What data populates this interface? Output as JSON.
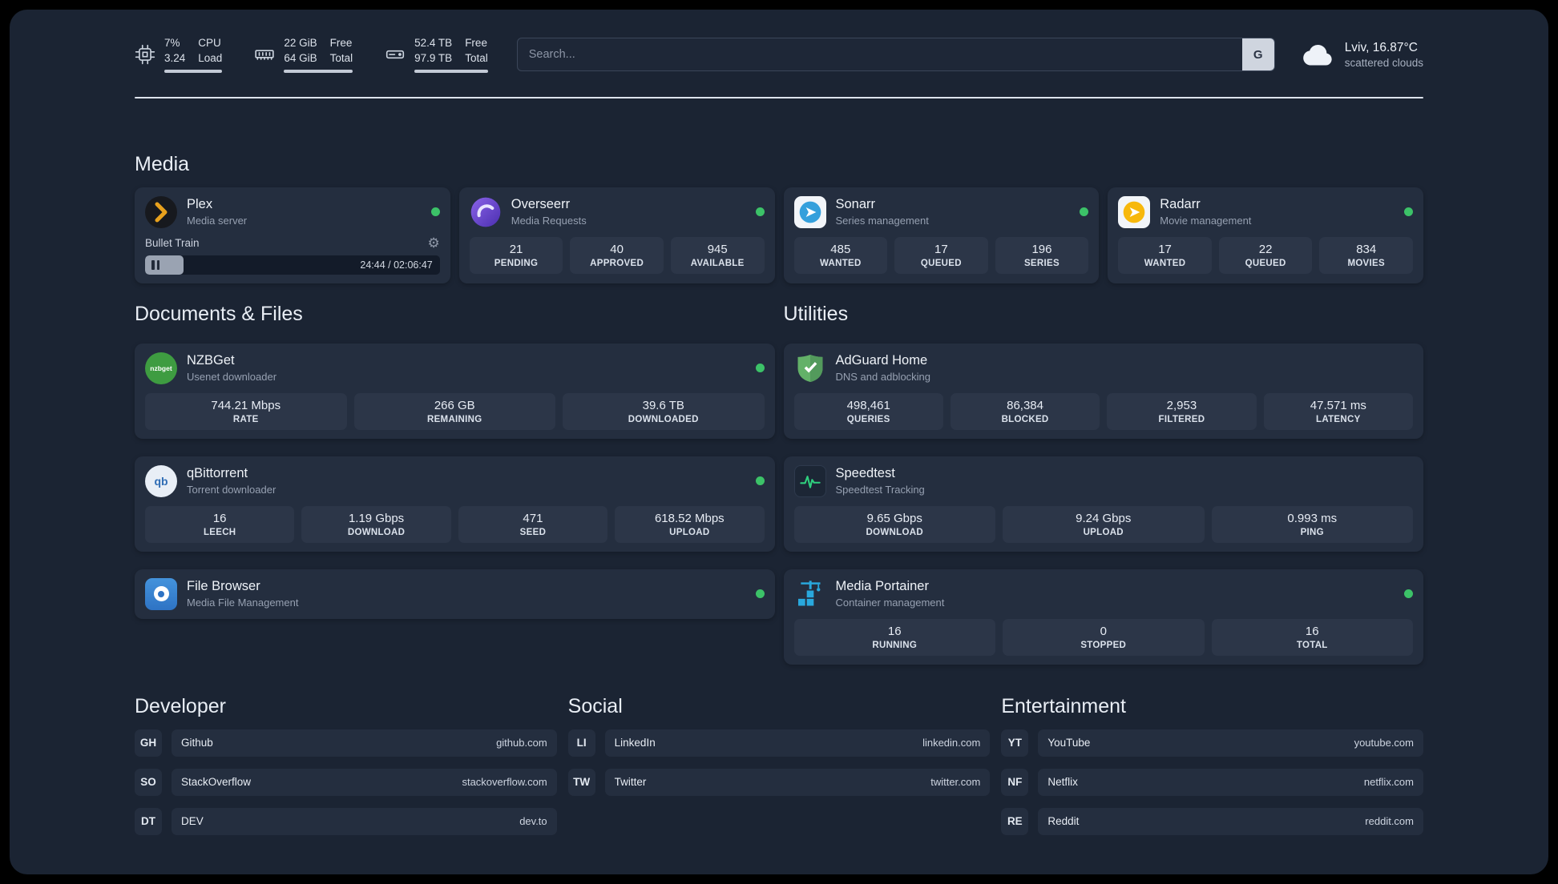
{
  "topbar": {
    "cpu": {
      "value_top": "7%",
      "value_bottom": "3.24",
      "label_top": "CPU",
      "label_bottom": "Load"
    },
    "memory": {
      "value_top": "22 GiB",
      "value_bottom": "64 GiB",
      "label_top": "Free",
      "label_bottom": "Total"
    },
    "disk": {
      "value_top": "52.4 TB",
      "value_bottom": "97.9 TB",
      "label_top": "Free",
      "label_bottom": "Total"
    },
    "search": {
      "placeholder": "Search...",
      "button_label": "G"
    },
    "weather": {
      "location": "Lviv, 16.87°C",
      "condition": "scattered clouds"
    }
  },
  "sections": {
    "media": "Media",
    "documents": "Documents & Files",
    "utilities": "Utilities"
  },
  "apps": {
    "plex": {
      "name": "Plex",
      "description": "Media server",
      "now_playing": {
        "track": "Bullet Train",
        "time": "24:44 / 02:06:47",
        "progress_percent": 13
      }
    },
    "overseerr": {
      "name": "Overseerr",
      "description": "Media Requests",
      "stats": [
        {
          "value": "21",
          "label": "PENDING"
        },
        {
          "value": "40",
          "label": "APPROVED"
        },
        {
          "value": "945",
          "label": "AVAILABLE"
        }
      ]
    },
    "sonarr": {
      "name": "Sonarr",
      "description": "Series management",
      "stats": [
        {
          "value": "485",
          "label": "WANTED"
        },
        {
          "value": "17",
          "label": "QUEUED"
        },
        {
          "value": "196",
          "label": "SERIES"
        }
      ]
    },
    "radarr": {
      "name": "Radarr",
      "description": "Movie management",
      "stats": [
        {
          "value": "17",
          "label": "WANTED"
        },
        {
          "value": "22",
          "label": "QUEUED"
        },
        {
          "value": "834",
          "label": "MOVIES"
        }
      ]
    },
    "nzbget": {
      "name": "NZBGet",
      "description": "Usenet downloader",
      "icon_text": "nzbget",
      "stats": [
        {
          "value": "744.21 Mbps",
          "label": "RATE"
        },
        {
          "value": "266 GB",
          "label": "REMAINING"
        },
        {
          "value": "39.6 TB",
          "label": "DOWNLOADED"
        }
      ]
    },
    "qbittorrent": {
      "name": "qBittorrent",
      "description": "Torrent downloader",
      "icon_text": "qb",
      "stats": [
        {
          "value": "16",
          "label": "LEECH"
        },
        {
          "value": "1.19 Gbps",
          "label": "DOWNLOAD"
        },
        {
          "value": "471",
          "label": "SEED"
        },
        {
          "value": "618.52 Mbps",
          "label": "UPLOAD"
        }
      ]
    },
    "filebrowser": {
      "name": "File Browser",
      "description": "Media File Management"
    },
    "adguard": {
      "name": "AdGuard Home",
      "description": "DNS and adblocking",
      "stats": [
        {
          "value": "498,461",
          "label": "QUERIES"
        },
        {
          "value": "86,384",
          "label": "BLOCKED"
        },
        {
          "value": "2,953",
          "label": "FILTERED"
        },
        {
          "value": "47.571 ms",
          "label": "LATENCY"
        }
      ]
    },
    "speedtest": {
      "name": "Speedtest",
      "description": "Speedtest Tracking",
      "stats": [
        {
          "value": "9.65 Gbps",
          "label": "DOWNLOAD"
        },
        {
          "value": "9.24 Gbps",
          "label": "UPLOAD"
        },
        {
          "value": "0.993 ms",
          "label": "PING"
        }
      ]
    },
    "portainer": {
      "name": "Media Portainer",
      "description": "Container management",
      "stats": [
        {
          "value": "16",
          "label": "RUNNING"
        },
        {
          "value": "0",
          "label": "STOPPED"
        },
        {
          "value": "16",
          "label": "TOTAL"
        }
      ]
    }
  },
  "bookmarks": {
    "developer": {
      "title": "Developer",
      "items": [
        {
          "abbr": "GH",
          "name": "Github",
          "url": "github.com"
        },
        {
          "abbr": "SO",
          "name": "StackOverflow",
          "url": "stackoverflow.com"
        },
        {
          "abbr": "DT",
          "name": "DEV",
          "url": "dev.to"
        }
      ]
    },
    "social": {
      "title": "Social",
      "items": [
        {
          "abbr": "LI",
          "name": "LinkedIn",
          "url": "linkedin.com"
        },
        {
          "abbr": "TW",
          "name": "Twitter",
          "url": "twitter.com"
        }
      ]
    },
    "entertainment": {
      "title": "Entertainment",
      "items": [
        {
          "abbr": "YT",
          "name": "YouTube",
          "url": "youtube.com"
        },
        {
          "abbr": "NF",
          "name": "Netflix",
          "url": "netflix.com"
        },
        {
          "abbr": "RE",
          "name": "Reddit",
          "url": "reddit.com"
        }
      ]
    }
  },
  "colors": {
    "background": "#1b2433",
    "card": "#242e3f",
    "tile": "#2c3648",
    "status_online": "#3cc268",
    "plex_accent": "#e8a11d",
    "overseerr_purple": "#6a4fd0",
    "sonarr_blue": "#35a0dc",
    "radarr_yellow": "#f7b80c",
    "nzbget_green": "#3e9c41",
    "adguard_green": "#63b168",
    "speedtest_green": "#2fd07e",
    "portainer_blue": "#29a8dd"
  }
}
